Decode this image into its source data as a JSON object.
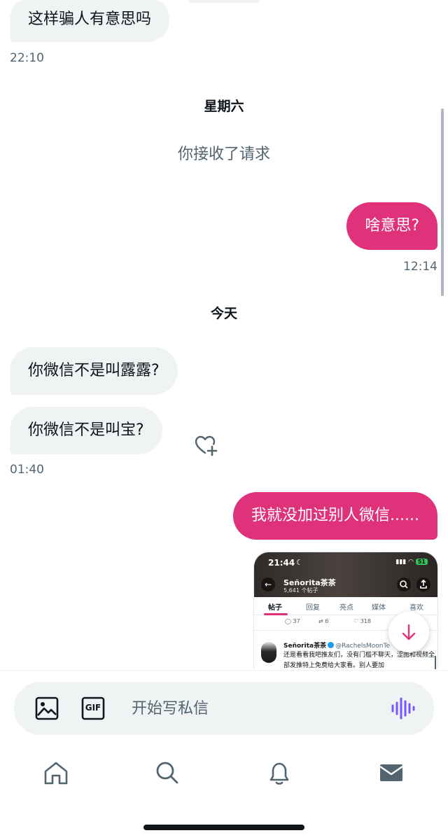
{
  "messages": [
    {
      "dir": "in",
      "text": "这样骗人有意思吗",
      "time": "22:10"
    },
    {
      "dir": "day",
      "text": "星期六"
    },
    {
      "dir": "system",
      "text": "你接收了请求"
    },
    {
      "dir": "out",
      "text": "啥意思?",
      "time": "12:14"
    },
    {
      "dir": "day",
      "text": "今天"
    },
    {
      "dir": "in",
      "text": "你微信不是叫露露?"
    },
    {
      "dir": "in",
      "text": "你微信不是叫宝?",
      "time": "01:40"
    },
    {
      "dir": "out",
      "text": "我就没加过别人微信......"
    }
  ],
  "preview": {
    "status_time": "21:44",
    "battery": "51",
    "profile_name": "Señorita茶茶",
    "post_count": "5,641 个帖子",
    "tabs": [
      "帖子",
      "回复",
      "亮点",
      "媒体",
      "喜欢"
    ],
    "active_tab": "帖子",
    "stats": {
      "replies": "37",
      "reposts": "6",
      "likes": "318"
    },
    "post_author": "Señorita茶茶",
    "post_handle": "@RachelsMoonTe",
    "post_text": "还是看看我吧推友们，没有门槛不聊天，涩图和视频全部发推特上免费给大家看。别人要加"
  },
  "composer": {
    "placeholder": "开始写私信",
    "image_icon": "image-icon",
    "gif_label": "GIF",
    "voice_icon": "voice-waveform-icon"
  },
  "tabbar": {
    "items": [
      "home-icon",
      "search-icon",
      "notifications-bell-icon",
      "messages-envelope-icon"
    ],
    "active": "messages-envelope-icon"
  },
  "colors": {
    "accent": "#e0317b",
    "incoming_bubble": "#eff3f4",
    "secondary_text": "#536471",
    "voice": "#7856ff"
  }
}
